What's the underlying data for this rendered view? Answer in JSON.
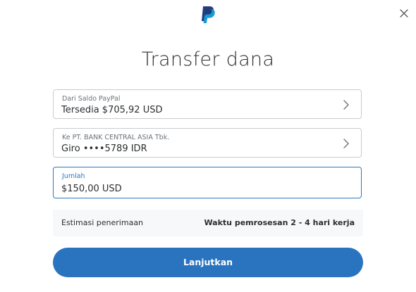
{
  "brand": {
    "logo_icon": "paypal-logo-icon",
    "color_dark": "#253b80",
    "color_light": "#179bd7"
  },
  "header": {
    "close_icon": "close-icon",
    "title": "Transfer dana"
  },
  "source": {
    "label": "Dari Saldo PayPal",
    "value": "Tersedia $705,92 USD"
  },
  "destination": {
    "label": "Ke PT. BANK CENTRAL ASIA Tbk.",
    "value": "Giro ••••5789 IDR"
  },
  "amount": {
    "label": "Jumlah",
    "value": "$150,00 USD"
  },
  "estimate": {
    "label": "Estimasi penerimaan",
    "value": "Waktu pemrosesan 2 - 4 hari kerja"
  },
  "actions": {
    "continue_label": "Lanjutkan",
    "accent": "#2a73bf"
  }
}
